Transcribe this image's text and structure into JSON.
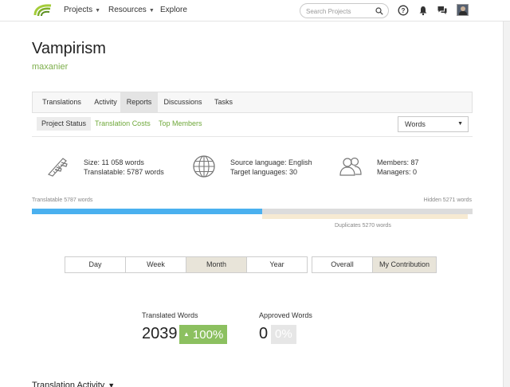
{
  "nav": {
    "projects": "Projects",
    "resources": "Resources",
    "explore": "Explore",
    "search_placeholder": "Search Projects"
  },
  "project": {
    "title": "Vampirism",
    "owner": "maxanier"
  },
  "tabs": [
    "Translations",
    "Activity",
    "Reports",
    "Discussions",
    "Tasks"
  ],
  "active_tab": "Reports",
  "subtabs": {
    "project_status": "Project Status",
    "translation_costs": "Translation Costs",
    "top_members": "Top Members"
  },
  "units_select": "Words",
  "stats": {
    "size": "Size: 11 058 words",
    "translatable": "Translatable: 5787 words",
    "source_language": "Source language: English",
    "target_languages": "Target languages: 30",
    "members": "Members: 87",
    "managers": "Managers: 0"
  },
  "progress": {
    "translatable_label": "Translatable 5787 words",
    "hidden_label": "Hidden 5271 words",
    "duplicates_label": "Duplicates 5270 words",
    "translatable_fraction": 0.523
  },
  "periods": [
    "Day",
    "Week",
    "Month",
    "Year"
  ],
  "active_period": "Month",
  "scopes": [
    "Overall",
    "My Contribution"
  ],
  "active_scope": "My Contribution",
  "totals": {
    "translated_label": "Translated Words",
    "translated_value": "2039",
    "translated_percent": "100%",
    "approved_label": "Approved Words",
    "approved_value": "0",
    "approved_percent": "0%"
  },
  "activity_heading": "Translation Activity",
  "colors": {
    "accent_green": "#7cae4a",
    "progress_blue": "#4ab0ef",
    "duplicates": "#f6ead2",
    "badge_green": "#8cc060"
  }
}
